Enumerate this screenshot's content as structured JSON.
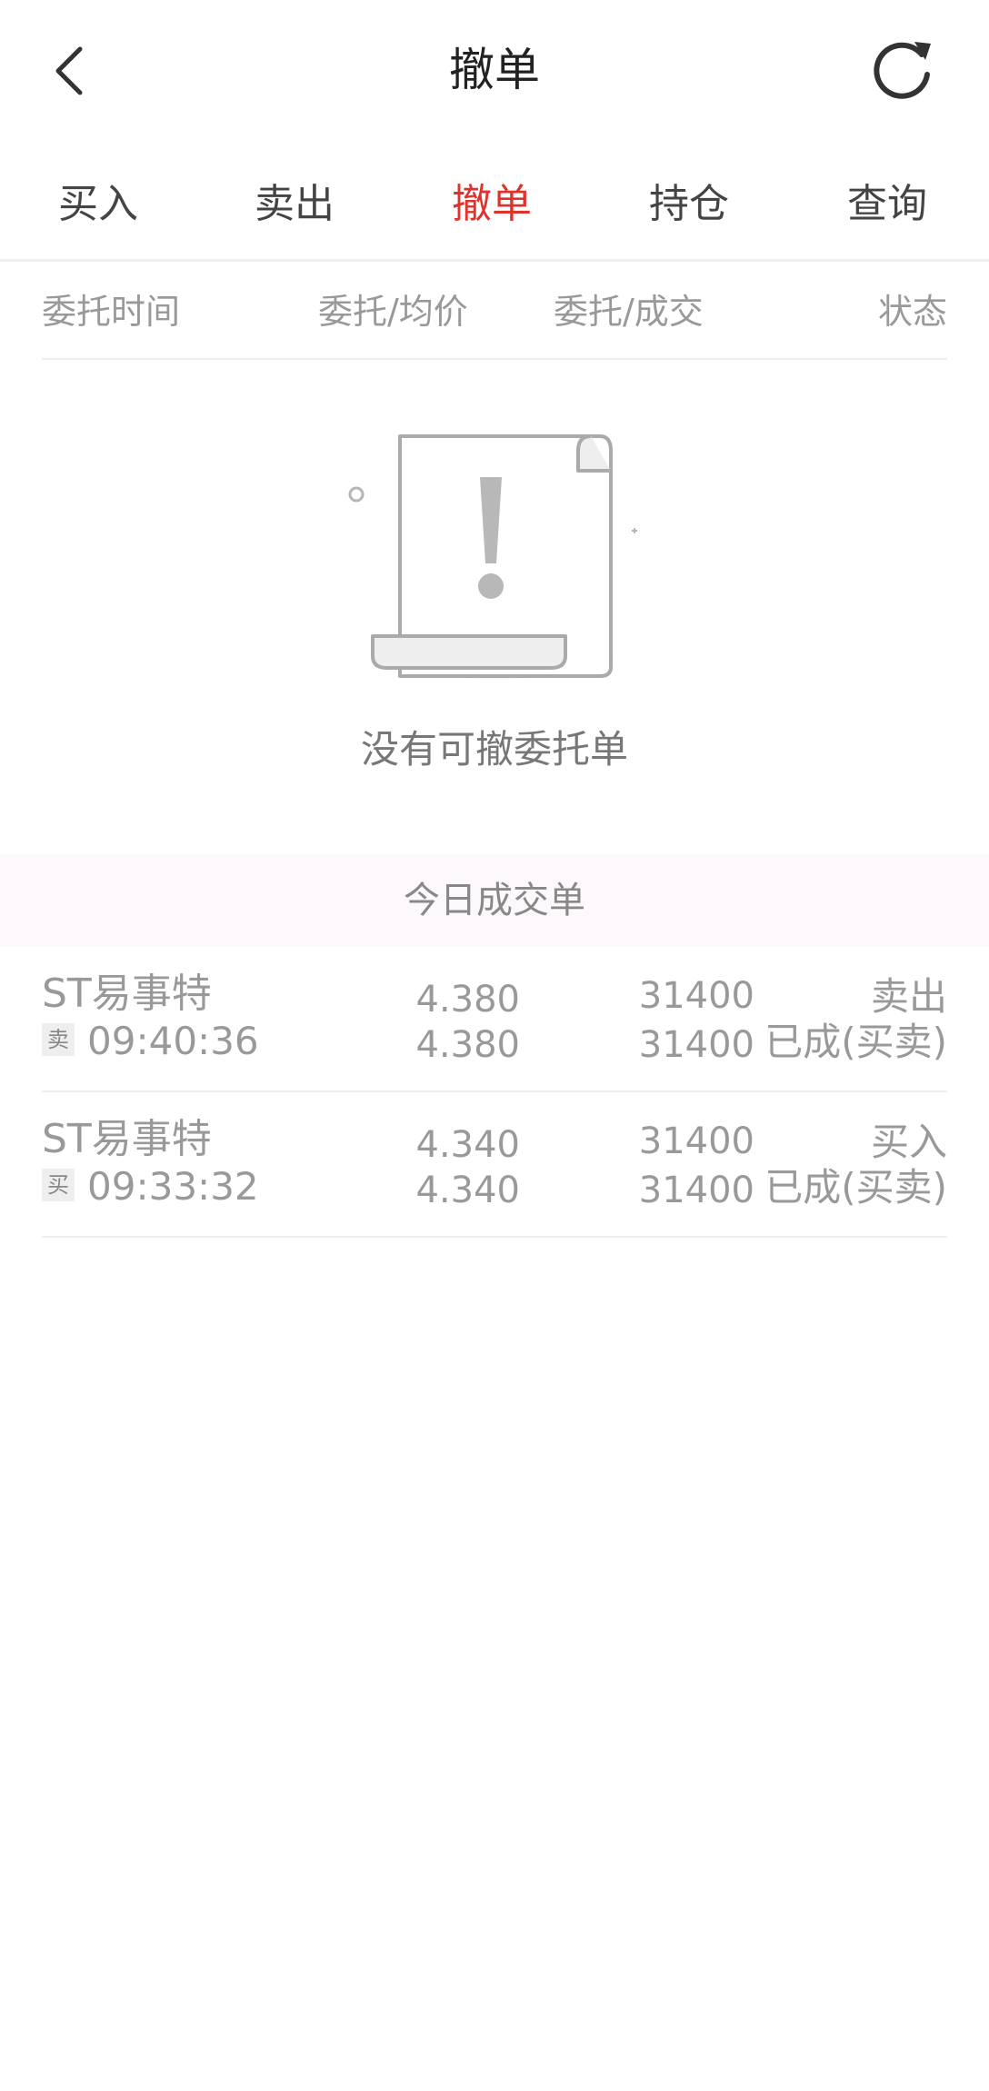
{
  "header": {
    "title": "撤单",
    "back_icon": "chevron-left-icon",
    "refresh_icon": "refresh-icon"
  },
  "tabs": [
    {
      "label": "买入"
    },
    {
      "label": "卖出"
    },
    {
      "label": "撤单"
    },
    {
      "label": "持仓"
    },
    {
      "label": "查询"
    }
  ],
  "active_tab": "撤单",
  "colors": {
    "accent": "#e0322c",
    "section_bg": "#fdf8fb"
  },
  "columns": [
    "委托时间",
    "委托/均价",
    "委托/成交",
    "状态"
  ],
  "empty_state": {
    "icon": "empty-document-icon",
    "text": "没有可撤委托单"
  },
  "today_section": {
    "title": "今日成交单"
  },
  "trades": [
    {
      "name": "ST易事特",
      "side_badge": "卖",
      "time": "09:40:36",
      "order_price": "4.380",
      "avg_price": "4.380",
      "order_qty": "31400",
      "filled_qty": "31400",
      "direction": "卖出",
      "status": "已成(买卖)"
    },
    {
      "name": "ST易事特",
      "side_badge": "买",
      "time": "09:33:32",
      "order_price": "4.340",
      "avg_price": "4.340",
      "order_qty": "31400",
      "filled_qty": "31400",
      "direction": "买入",
      "status": "已成(买卖)"
    }
  ]
}
